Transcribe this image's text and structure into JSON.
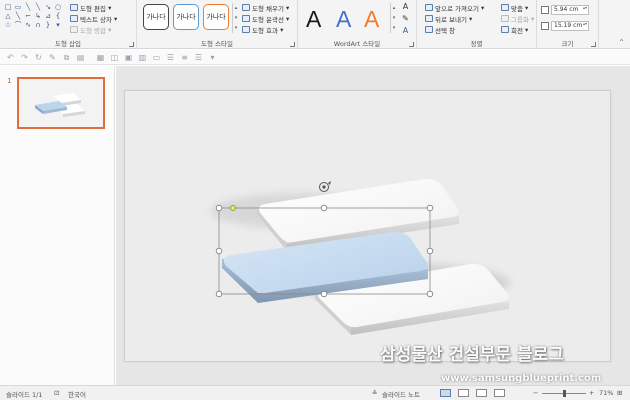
{
  "ribbon": {
    "insert_shapes": {
      "label": "도형 삽입",
      "edit_shape": "도형 편집",
      "text_box": "텍스트 상자",
      "merge_shapes": "도형 병합"
    },
    "shape_styles": {
      "label": "도형 스타일",
      "thumb_text": "가나다",
      "thumb_border_colors": [
        "#444444",
        "#5b9bd5",
        "#ed7d31"
      ],
      "fill": "도형 채우기",
      "outline": "도형 윤곽선",
      "effects": "도형 효과"
    },
    "wordart": {
      "label": "WordArt 스타일",
      "letter": "A",
      "colors": [
        "#1a1a1a",
        "#4472c4",
        "#ed7d31"
      ]
    },
    "arrange": {
      "label": "정렬",
      "bring_forward": "앞으로 가져오기",
      "send_backward": "뒤로 보내기",
      "selection_pane": "선택 창",
      "align": "맞춤",
      "group": "그룹화",
      "rotate": "회전"
    },
    "size": {
      "label": "크기",
      "height": "5.94 cm",
      "width": "15.19 cm"
    }
  },
  "slides": {
    "number": "1"
  },
  "statusbar": {
    "slide_info": "슬라이드 1/1",
    "language": "한국어",
    "notes": "슬라이드 노트",
    "zoom": "71%",
    "zoom_fraction": 0.5
  },
  "watermark": {
    "title": "삼성물산 건설부문 블로그",
    "url": "www.samsungblueprint.com"
  }
}
